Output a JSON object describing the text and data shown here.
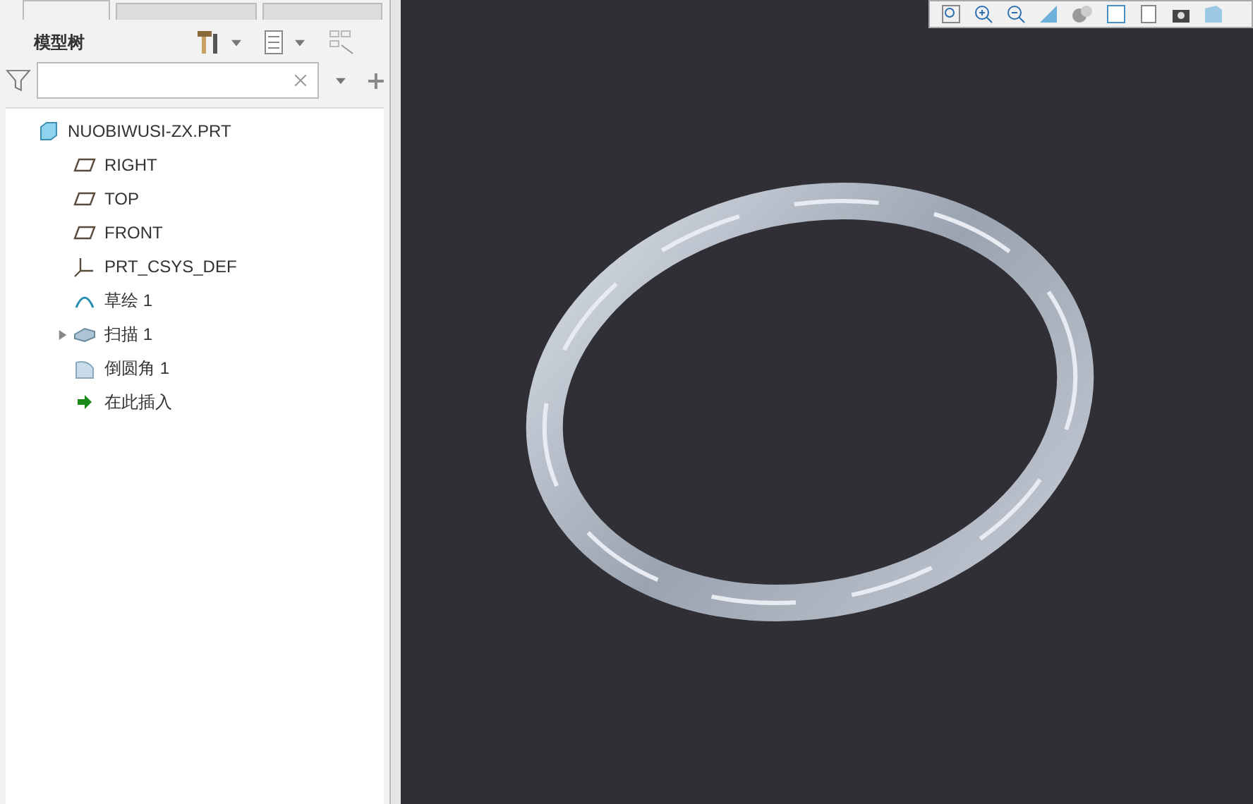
{
  "tabs": [
    {
      "selected": true
    },
    {
      "selected": false
    },
    {
      "selected": false
    }
  ],
  "panel": {
    "title": "模型树"
  },
  "tree": [
    {
      "kind": "part",
      "label": "NUOBIWUSI-ZX.PRT",
      "children": [
        {
          "kind": "plane",
          "label": "RIGHT"
        },
        {
          "kind": "plane",
          "label": "TOP"
        },
        {
          "kind": "plane",
          "label": "FRONT"
        },
        {
          "kind": "csys",
          "label": "PRT_CSYS_DEF"
        },
        {
          "kind": "sketch",
          "label": "草绘 1"
        },
        {
          "kind": "sweep",
          "label": "扫描 1",
          "expanded": false
        },
        {
          "kind": "round",
          "label": "倒圆角 1"
        },
        {
          "kind": "insert",
          "label": "在此插入"
        }
      ]
    }
  ]
}
